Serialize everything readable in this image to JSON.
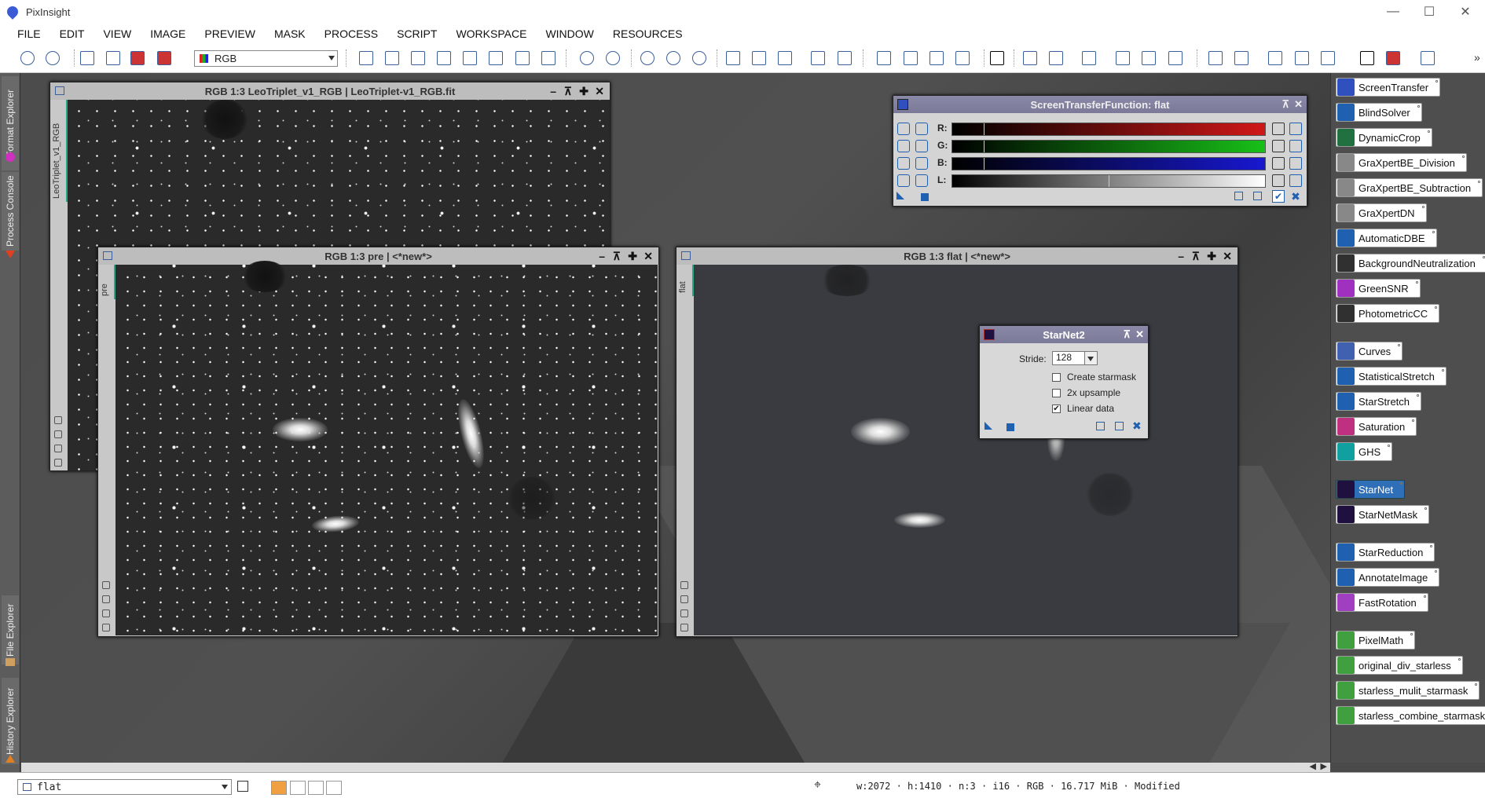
{
  "app": {
    "title": "PixInsight"
  },
  "menu": [
    "FILE",
    "EDIT",
    "VIEW",
    "IMAGE",
    "PREVIEW",
    "MASK",
    "PROCESS",
    "SCRIPT",
    "WORKSPACE",
    "WINDOW",
    "RESOURCES"
  ],
  "toolbar": {
    "channel_select": "RGB"
  },
  "left_dock": {
    "tabs": [
      "Format Explorer",
      "Process Console",
      "File Explorer",
      "History Explorer"
    ]
  },
  "windows": {
    "leo": {
      "title": "RGB 1:3 LeoTriplet_v1_RGB | LeoTriplet-v1_RGB.fit",
      "side_label": "LeoTriplet_v1_RGB"
    },
    "pre": {
      "title": "RGB 1:3 pre | <*new*>",
      "side_label": "pre"
    },
    "flat": {
      "title": "RGB 1:3 flat | <*new*>",
      "side_label": "flat"
    }
  },
  "stf": {
    "title": "ScreenTransferFunction: flat",
    "rows": [
      {
        "label": "R:",
        "color": "#d01818",
        "midtone": 0.1
      },
      {
        "label": "G:",
        "color": "#18c018",
        "midtone": 0.1
      },
      {
        "label": "B:",
        "color": "#1818d0",
        "midtone": 0.1
      },
      {
        "label": "L:",
        "color": "#ffffff",
        "midtone": 0.5
      }
    ]
  },
  "starnet": {
    "title": "StarNet2",
    "stride_label": "Stride:",
    "stride_value": "128",
    "options": [
      {
        "label": "Create starmask",
        "checked": false
      },
      {
        "label": "2x upsample",
        "checked": false
      },
      {
        "label": "Linear data",
        "checked": true
      }
    ]
  },
  "process_icons": [
    {
      "label": "ScreenTransfer",
      "color": "#3050c0"
    },
    {
      "label": "BlindSolver",
      "color": "#2060b0"
    },
    {
      "label": "DynamicCrop",
      "color": "#207040"
    },
    {
      "label": "GraXpertBE_Division",
      "color": "#888888"
    },
    {
      "label": "GraXpertBE_Subtraction",
      "color": "#888888"
    },
    {
      "label": "GraXpertDN",
      "color": "#888888"
    },
    {
      "label": "AutomaticDBE",
      "color": "#2060b0"
    },
    {
      "label": "BackgroundNeutralization",
      "color": "#303030"
    },
    {
      "label": "GreenSNR",
      "color": "#a030c0"
    },
    {
      "label": "PhotometricCC",
      "color": "#303030"
    },
    {
      "label": "Curves",
      "color": "#4060b0"
    },
    {
      "label": "StatisticalStretch",
      "color": "#2060b0"
    },
    {
      "label": "StarStretch",
      "color": "#2060b0"
    },
    {
      "label": "Saturation",
      "color": "#c03080"
    },
    {
      "label": "GHS",
      "color": "#10a0a0"
    },
    {
      "label": "StarNet",
      "color": "#201040"
    },
    {
      "label": "StarNetMask",
      "color": "#201040"
    },
    {
      "label": "StarReduction",
      "color": "#2060b0"
    },
    {
      "label": "AnnotateImage",
      "color": "#2060b0"
    },
    {
      "label": "FastRotation",
      "color": "#a040c0"
    },
    {
      "label": "PixelMath",
      "color": "#40a040"
    },
    {
      "label": "original_div_starless",
      "color": "#40a040"
    },
    {
      "label": "starless_mulit_starmask",
      "color": "#40a040"
    },
    {
      "label": "starless_combine_starmask",
      "color": "#40a040"
    }
  ],
  "status": {
    "view": "flat",
    "info": "w:2072 · h:1410 · n:3 · i16 · RGB · 16.717 MiB · Modified"
  }
}
